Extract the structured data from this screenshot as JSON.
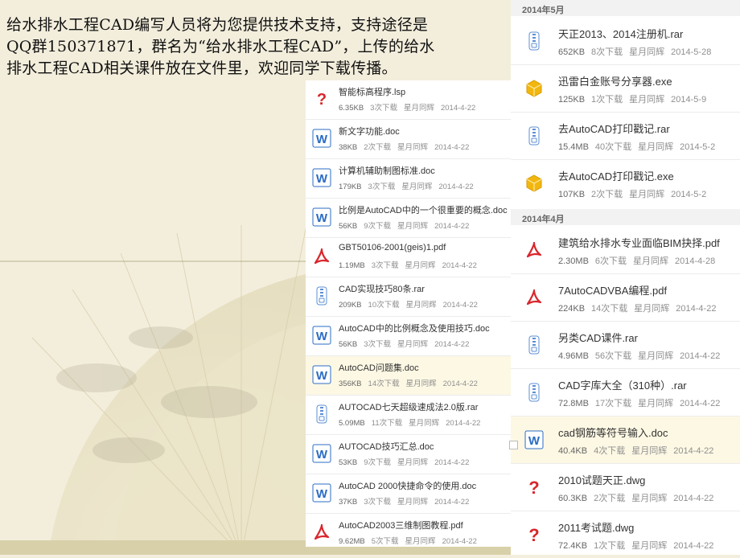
{
  "notice_lines": [
    "给水排水工程CAD编写人员将为您提供技术支持，支持途径是",
    "QQ群150371871，群名为“给水排水工程CAD”，上传的给水",
    "排水工程CAD相关课件放在文件里，欢迎同学下载传播。"
  ],
  "left_files": [
    {
      "name": "智能标高程序.lsp",
      "size": "6.35KB",
      "downloads": "3次下载",
      "uploader": "星月同辉",
      "date": "2014-4-22",
      "icon": "question-icon"
    },
    {
      "name": "新文字功能.doc",
      "size": "38KB",
      "downloads": "2次下载",
      "uploader": "星月同辉",
      "date": "2014-4-22",
      "icon": "word-icon"
    },
    {
      "name": "计算机辅助制图标准.doc",
      "size": "179KB",
      "downloads": "3次下载",
      "uploader": "星月同辉",
      "date": "2014-4-22",
      "icon": "word-icon"
    },
    {
      "name": "比例是AutoCAD中的一个很重要的概念.doc",
      "size": "56KB",
      "downloads": "9次下载",
      "uploader": "星月同辉",
      "date": "2014-4-22",
      "icon": "word-icon"
    },
    {
      "name": "GBT50106-2001(geis)1.pdf",
      "size": "1.19MB",
      "downloads": "3次下载",
      "uploader": "星月同辉",
      "date": "2014-4-22",
      "icon": "pdf-icon"
    },
    {
      "name": "CAD实现技巧80条.rar",
      "size": "209KB",
      "downloads": "10次下载",
      "uploader": "星月同辉",
      "date": "2014-4-22",
      "icon": "zip-icon"
    },
    {
      "name": "AutoCAD中的比例概念及使用技巧.doc",
      "size": "56KB",
      "downloads": "3次下载",
      "uploader": "星月同辉",
      "date": "2014-4-22",
      "icon": "word-icon"
    },
    {
      "name": "AutoCAD问题集.doc",
      "size": "356KB",
      "downloads": "14次下载",
      "uploader": "星月同辉",
      "date": "2014-4-22",
      "icon": "word-icon"
    },
    {
      "name": "AUTOCAD七天超级速成法2.0版.rar",
      "size": "5.09MB",
      "downloads": "11次下载",
      "uploader": "星月同辉",
      "date": "2014-4-22",
      "icon": "zip-icon"
    },
    {
      "name": "AUTOCAD技巧汇总.doc",
      "size": "53KB",
      "downloads": "9次下载",
      "uploader": "星月同辉",
      "date": "2014-4-22",
      "icon": "word-icon"
    },
    {
      "name": "AutoCAD 2000快捷命令的使用.doc",
      "size": "37KB",
      "downloads": "3次下载",
      "uploader": "星月同辉",
      "date": "2014-4-22",
      "icon": "word-icon"
    },
    {
      "name": "AutoCAD2003三维制图教程.pdf",
      "size": "9.62MB",
      "downloads": "5次下载",
      "uploader": "星月同辉",
      "date": "2014-4-22",
      "icon": "pdf-icon"
    }
  ],
  "right_groups": [
    {
      "title": "2014年5月",
      "files": [
        {
          "name": "天正2013、2014注册机.rar",
          "size": "652KB",
          "downloads": "8次下载",
          "uploader": "星月同辉",
          "date": "2014-5-28",
          "icon": "zip-icon"
        },
        {
          "name": "迅雷白金账号分享器.exe",
          "size": "125KB",
          "downloads": "1次下载",
          "uploader": "星月同辉",
          "date": "2014-5-9",
          "icon": "exe-icon"
        },
        {
          "name": "去AutoCAD打印戳记.rar",
          "size": "15.4MB",
          "downloads": "40次下载",
          "uploader": "星月同辉",
          "date": "2014-5-2",
          "icon": "zip-icon"
        },
        {
          "name": "去AutoCAD打印戳记.exe",
          "size": "107KB",
          "downloads": "2次下载",
          "uploader": "星月同辉",
          "date": "2014-5-2",
          "icon": "exe-icon"
        }
      ]
    },
    {
      "title": "2014年4月",
      "files": [
        {
          "name": "建筑给水排水专业面临BIM抉择.pdf",
          "size": "2.30MB",
          "downloads": "6次下载",
          "uploader": "星月同辉",
          "date": "2014-4-28",
          "icon": "pdf-icon"
        },
        {
          "name": "7AutoCADVBA编程.pdf",
          "size": "224KB",
          "downloads": "14次下载",
          "uploader": "星月同辉",
          "date": "2014-4-22",
          "icon": "pdf-icon"
        },
        {
          "name": "另类CAD课件.rar",
          "size": "4.96MB",
          "downloads": "56次下载",
          "uploader": "星月同辉",
          "date": "2014-4-22",
          "icon": "zip-icon"
        },
        {
          "name": "CAD字库大全（310种）.rar",
          "size": "72.8MB",
          "downloads": "17次下载",
          "uploader": "星月同辉",
          "date": "2014-4-22",
          "icon": "zip-icon"
        },
        {
          "name": "cad钢筋等符号输入.doc",
          "size": "40.4KB",
          "downloads": "4次下载",
          "uploader": "星月同辉",
          "date": "2014-4-22",
          "icon": "word-icon"
        },
        {
          "name": "2010试题天正.dwg",
          "size": "60.3KB",
          "downloads": "2次下载",
          "uploader": "星月同辉",
          "date": "2014-4-22",
          "icon": "question-icon"
        },
        {
          "name": "2011考试题.dwg",
          "size": "72.4KB",
          "downloads": "1次下载",
          "uploader": "星月同辉",
          "date": "2014-4-22",
          "icon": "question-icon"
        }
      ]
    }
  ]
}
